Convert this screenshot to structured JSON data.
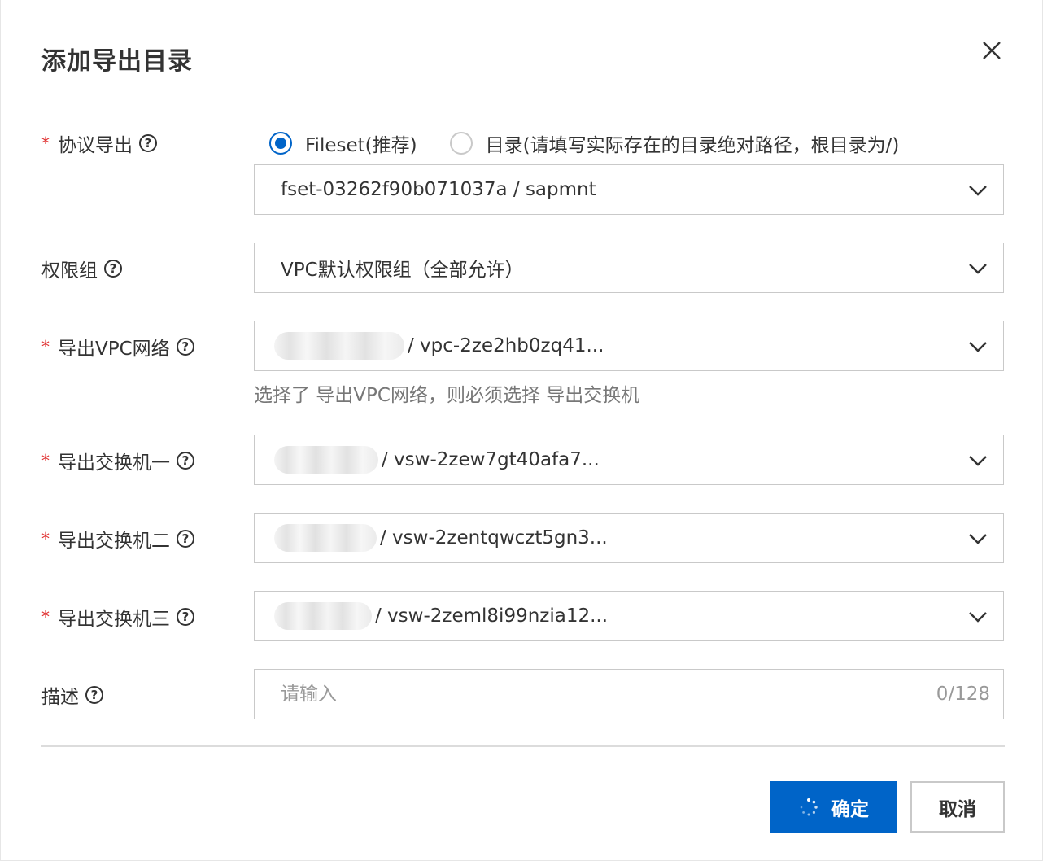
{
  "dialog": {
    "title": "添加导出目录",
    "close_label": "×"
  },
  "protocol_export": {
    "label": "协议导出",
    "required": "*",
    "options": [
      {
        "label": "Fileset(推荐)",
        "checked": true
      },
      {
        "label": "目录(请填写实际存在的目录绝对路径，根目录为/)",
        "checked": false
      }
    ],
    "fileset_value": "fset-03262f90b071037a / sapmnt"
  },
  "permission_group": {
    "label": "权限组",
    "value": "VPC默认权限组（全部允许）"
  },
  "export_vpc": {
    "label": "导出VPC网络",
    "required": "*",
    "value": "/ vpc-2ze2hb0zq41...",
    "hint": "选择了 导出VPC网络，则必须选择 导出交换机"
  },
  "switch_1": {
    "label": "导出交换机一",
    "required": "*",
    "value": "/ vsw-2zew7gt40afa7..."
  },
  "switch_2": {
    "label": "导出交换机二",
    "required": "*",
    "value": "/ vsw-2zentqwczt5gn3..."
  },
  "switch_3": {
    "label": "导出交换机三",
    "required": "*",
    "value": "/ vsw-2zeml8i99nzia12..."
  },
  "description": {
    "label": "描述",
    "placeholder": "请输入",
    "counter": "0/128"
  },
  "footer": {
    "ok_label": "确定",
    "cancel_label": "取消"
  },
  "help_glyph": "?",
  "colors": {
    "primary": "#0064c8",
    "required": "#e03030",
    "border": "#c9c9c9"
  },
  "icons": [
    "close-icon",
    "help-icon",
    "chevron-down-icon",
    "loading-spinner-icon"
  ]
}
